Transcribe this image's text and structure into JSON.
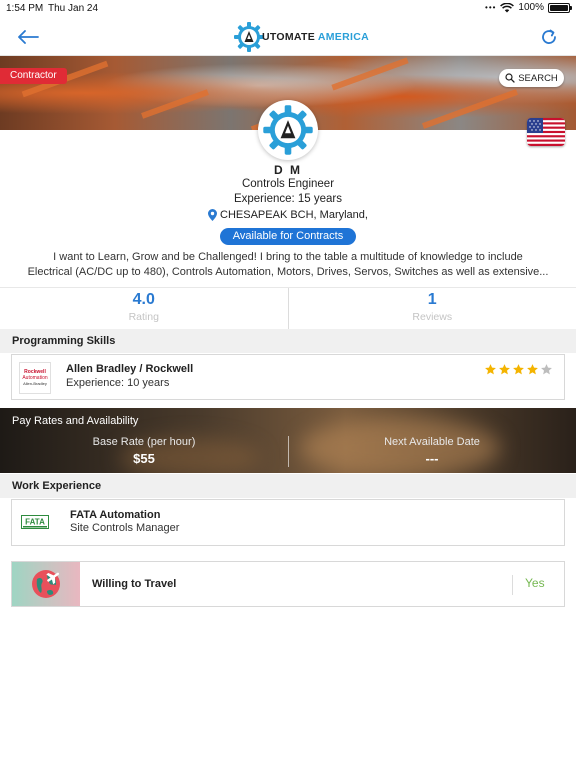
{
  "status_bar": {
    "time": "1:54 PM",
    "date": "Thu Jan 24",
    "battery": "100%"
  },
  "header": {
    "brand_part1": "UTOMATE",
    "brand_part2": "AMERICA"
  },
  "banner": {
    "badge": "Contractor",
    "search_label": "SEARCH"
  },
  "profile": {
    "name": "D M",
    "title": "Controls Engineer",
    "experience": "Experience: 15 years",
    "location": "CHESAPEAK BCH, Maryland,",
    "availability": "Available for Contracts",
    "bio_line1": "I want to Learn, Grow and be Challenged! I bring to the table a multitude of knowledge to include",
    "bio_line2": "Electrical (AC/DC up to 480), Controls Automation, Motors, Drives, Servos, Switches as well as extensive..."
  },
  "stats": {
    "rating_value": "4.0",
    "rating_label": "Rating",
    "reviews_value": "1",
    "reviews_label": "Reviews"
  },
  "programming_skills": {
    "header": "Programming Skills",
    "items": [
      {
        "name": "Allen Bradley / Rockwell",
        "experience": "Experience: 10 years",
        "stars": 4,
        "max_stars": 5,
        "logo_line1": "Rockwell",
        "logo_line2": "Automation",
        "logo_line3": "Allen-Bradley"
      }
    ]
  },
  "pay_rates": {
    "header": "Pay Rates and Availability",
    "base_rate_label": "Base Rate (per hour)",
    "base_rate_value": "$55",
    "next_available_label": "Next Available Date",
    "next_available_value": "---"
  },
  "work_experience": {
    "header": "Work Experience",
    "items": [
      {
        "company": "FATA Automation",
        "role": "Site Controls Manager",
        "logo_text": "FATA"
      }
    ]
  },
  "travel": {
    "label": "Willing to Travel",
    "value": "Yes"
  },
  "colors": {
    "accent_blue": "#2a7ad1",
    "badge_red": "#e02b36",
    "star": "#f4b400",
    "yes_green": "#76b852"
  },
  "icons": [
    "back-arrow-icon",
    "refresh-icon",
    "search-icon",
    "location-pin-icon",
    "star-icon",
    "globe-plane-icon",
    "us-flag-icon"
  ]
}
